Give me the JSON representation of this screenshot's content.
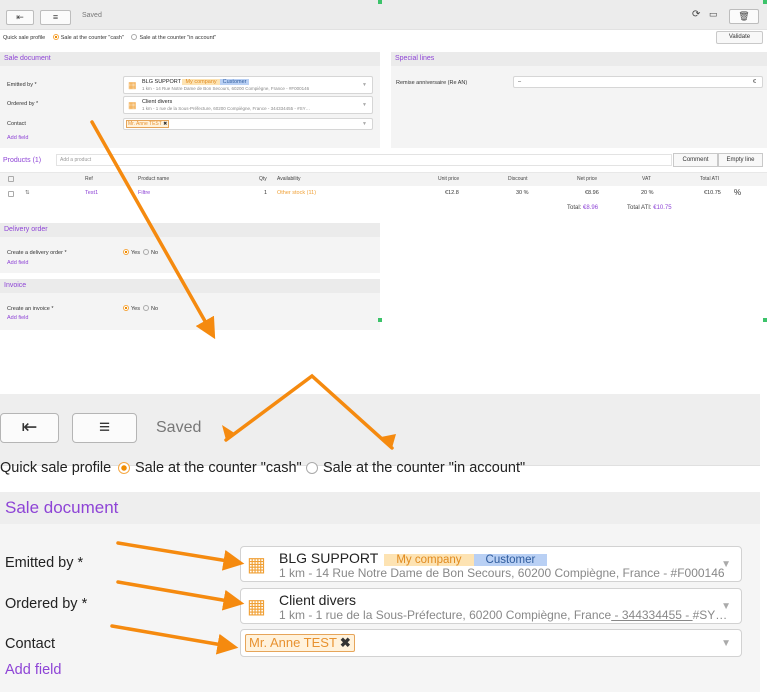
{
  "toolbar": {
    "saved_label": "Saved",
    "validate_label": "Validate"
  },
  "quick_sale": {
    "label": "Quick sale profile",
    "options": [
      "Sale at the counter \"cash\"",
      "Sale at the counter \"in account\""
    ],
    "selected_index": 0
  },
  "sale_document": {
    "title": "Sale document",
    "emitted_by": {
      "label": "Emitted by *",
      "name": "BLG SUPPORT",
      "tags": [
        "My company",
        "Customer"
      ],
      "address": "1 km - 14 Rue Notre Dame de Bon Secours, 60200 Compiègne, France - #F000146"
    },
    "ordered_by": {
      "label": "Ordered by *",
      "name": "Client divers",
      "address": "1 km - 1 rue de la Sous-Préfecture, 60200 Compiègne, France",
      "phone": " - 344334455 - ",
      "suffix": "#SY…"
    },
    "contact": {
      "label": "Contact",
      "value": "Mr. Anne TEST"
    },
    "add_field": "Add field"
  },
  "special_lines": {
    "title": "Special lines",
    "row": {
      "label": "Remise anniversaire (Re AN)",
      "value": "–",
      "currency": "€"
    }
  },
  "products": {
    "title": "Products (1)",
    "add_placeholder": "Add a product",
    "buttons": {
      "comment": "Comment",
      "empty_line": "Empty line"
    },
    "columns": [
      "Ref",
      "Product name",
      "Qty",
      "Availability",
      "Unit price",
      "Discount",
      "Net price",
      "VAT",
      "Total ATI"
    ],
    "rows": [
      {
        "ref": "Test1",
        "name": "Filtre",
        "qty": "1",
        "availability": "Other stock (11)",
        "unit_price": "€12.8",
        "discount": "30 %",
        "net_price": "€8.96",
        "vat": "20 %",
        "total_ati": "€10.75",
        "pct": "%"
      }
    ],
    "total_label": "Total:",
    "total_value": "€8.96",
    "total_ati_label": "Total ATI:",
    "total_ati_value": "€10.75"
  },
  "delivery_order": {
    "title": "Delivery order",
    "label": "Create a delivery order *",
    "yes": "Yes",
    "no": "No",
    "add_field": "Add field"
  },
  "invoice": {
    "title": "Invoice",
    "label": "Create an invoice *",
    "yes": "Yes",
    "no": "No",
    "add_field": "Add field"
  },
  "colors": {
    "accent": "#8e44d6",
    "selection": "#f08c00",
    "annotation_arrow": "#f58a0f"
  },
  "icons": [
    "back-arrow-icon",
    "list-icon",
    "refresh-icon",
    "screen-icon",
    "trash-icon",
    "building-icon",
    "chevron-down-icon",
    "close-icon"
  ]
}
